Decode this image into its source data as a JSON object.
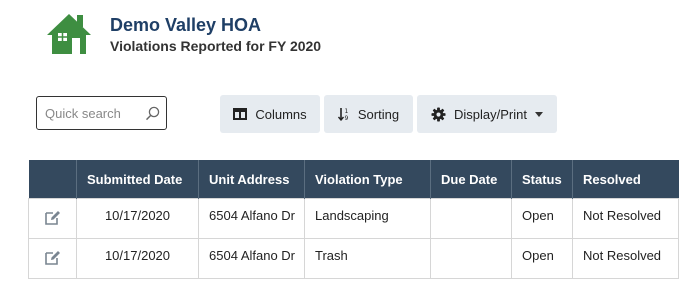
{
  "header": {
    "org_name": "Demo Valley HOA",
    "subtitle": "Violations Reported for FY 2020",
    "logo_icon": "house-icon",
    "logo_color": "#3e8e41"
  },
  "toolbar": {
    "search_placeholder": "Quick search",
    "search_value": "",
    "columns_label": "Columns",
    "sorting_label": "Sorting",
    "display_label": "Display/Print"
  },
  "table": {
    "header_bg": "#34495e",
    "columns": [
      "Submitted Date",
      "Unit Address",
      "Violation Type",
      "Due Date",
      "Status",
      "Resolved"
    ],
    "rows": [
      {
        "submitted": "10/17/2020",
        "address": "6504 Alfano Dr",
        "type": "Landscaping",
        "due": "",
        "status": "Open",
        "resolved": "Not Resolved"
      },
      {
        "submitted": "10/17/2020",
        "address": "6504 Alfano Dr",
        "type": "Trash",
        "due": "",
        "status": "Open",
        "resolved": "Not Resolved"
      }
    ]
  }
}
